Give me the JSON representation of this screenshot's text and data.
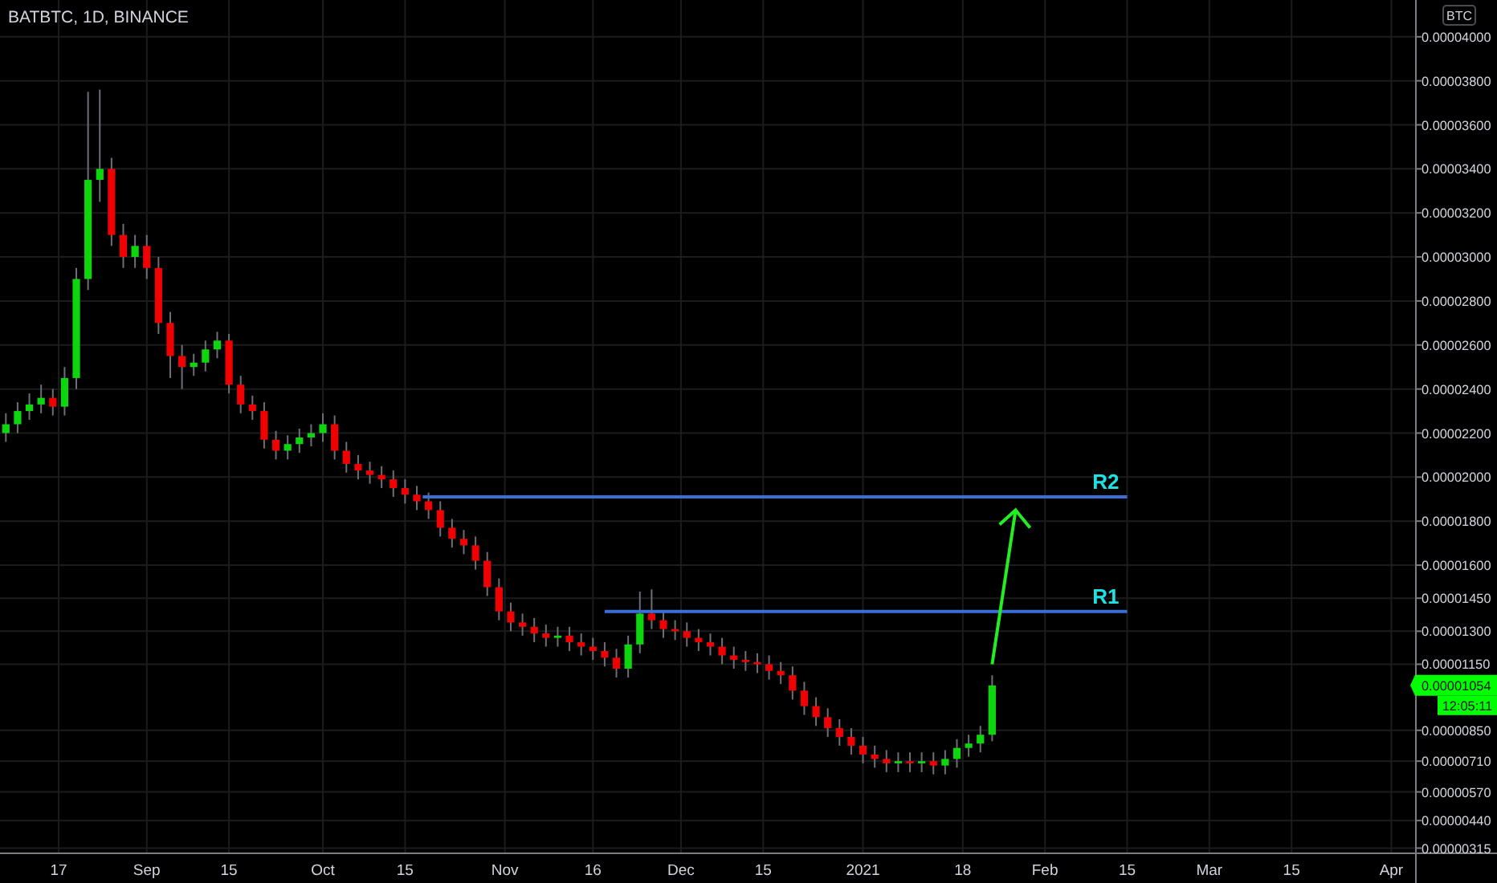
{
  "chart_title": "BATBTC, 1D, BINANCE",
  "currency_button": "BTC",
  "price_label": {
    "price": "0.00001054",
    "countdown": "12:05:11"
  },
  "chart_data": {
    "type": "candlestick",
    "grid": true,
    "xlim": [
      "2020-08-07",
      "2021-04-19"
    ],
    "ylim": [
      2.95e-06,
      4.167e-05
    ],
    "xticks": [
      {
        "value": "2020-08-17",
        "label": "17"
      },
      {
        "value": "2020-09-01",
        "label": "Sep"
      },
      {
        "value": "2020-09-15",
        "label": "15"
      },
      {
        "value": "2020-10-01",
        "label": "Oct"
      },
      {
        "value": "2020-10-15",
        "label": "15"
      },
      {
        "value": "2020-11-01",
        "label": "Nov"
      },
      {
        "value": "2020-11-16",
        "label": "16"
      },
      {
        "value": "2020-12-01",
        "label": "Dec"
      },
      {
        "value": "2020-12-15",
        "label": "15"
      },
      {
        "value": "2021-01-01",
        "label": "2021"
      },
      {
        "value": "2021-01-18",
        "label": "18"
      },
      {
        "value": "2021-02-01",
        "label": "Feb"
      },
      {
        "value": "2021-02-15",
        "label": "15"
      },
      {
        "value": "2021-03-01",
        "label": "Mar"
      },
      {
        "value": "2021-03-15",
        "label": "15"
      },
      {
        "value": "2021-04-01",
        "label": "Apr"
      }
    ],
    "yticks": [
      {
        "value": 4e-05,
        "label": "0.00004000"
      },
      {
        "value": 3.8e-05,
        "label": "0.00003800"
      },
      {
        "value": 3.6e-05,
        "label": "0.00003600"
      },
      {
        "value": 3.4e-05,
        "label": "0.00003400"
      },
      {
        "value": 3.2e-05,
        "label": "0.00003200"
      },
      {
        "value": 3e-05,
        "label": "0.00003000"
      },
      {
        "value": 2.8e-05,
        "label": "0.00002800"
      },
      {
        "value": 2.6e-05,
        "label": "0.00002600"
      },
      {
        "value": 2.4e-05,
        "label": "0.00002400"
      },
      {
        "value": 2.2e-05,
        "label": "0.00002200"
      },
      {
        "value": 2e-05,
        "label": "0.00002000"
      },
      {
        "value": 1.8e-05,
        "label": "0.00001800"
      },
      {
        "value": 1.6e-05,
        "label": "0.00001600"
      },
      {
        "value": 1.45e-05,
        "label": "0.00001450"
      },
      {
        "value": 1.3e-05,
        "label": "0.00001300"
      },
      {
        "value": 1.15e-05,
        "label": "0.00001150"
      },
      {
        "value": 8.5e-06,
        "label": "0.00000850"
      },
      {
        "value": 7.1e-06,
        "label": "0.00000710"
      },
      {
        "value": 5.7e-06,
        "label": "0.00000570"
      },
      {
        "value": 4.4e-06,
        "label": "0.00000440"
      },
      {
        "value": 3.15e-06,
        "label": "0.00000315"
      }
    ],
    "x": [
      "2020-08-08",
      "2020-08-10",
      "2020-08-12",
      "2020-08-14",
      "2020-08-16",
      "2020-08-18",
      "2020-08-20",
      "2020-08-22",
      "2020-08-24",
      "2020-08-26",
      "2020-08-28",
      "2020-08-30",
      "2020-09-01",
      "2020-09-03",
      "2020-09-05",
      "2020-09-07",
      "2020-09-09",
      "2020-09-11",
      "2020-09-13",
      "2020-09-15",
      "2020-09-17",
      "2020-09-19",
      "2020-09-21",
      "2020-09-23",
      "2020-09-25",
      "2020-09-27",
      "2020-09-29",
      "2020-10-01",
      "2020-10-03",
      "2020-10-05",
      "2020-10-07",
      "2020-10-09",
      "2020-10-11",
      "2020-10-13",
      "2020-10-15",
      "2020-10-17",
      "2020-10-19",
      "2020-10-21",
      "2020-10-23",
      "2020-10-25",
      "2020-10-27",
      "2020-10-29",
      "2020-10-31",
      "2020-11-02",
      "2020-11-04",
      "2020-11-06",
      "2020-11-08",
      "2020-11-10",
      "2020-11-12",
      "2020-11-14",
      "2020-11-16",
      "2020-11-18",
      "2020-11-20",
      "2020-11-22",
      "2020-11-24",
      "2020-11-26",
      "2020-11-28",
      "2020-11-30",
      "2020-12-02",
      "2020-12-04",
      "2020-12-06",
      "2020-12-08",
      "2020-12-10",
      "2020-12-12",
      "2020-12-14",
      "2020-12-16",
      "2020-12-18",
      "2020-12-20",
      "2020-12-22",
      "2020-12-24",
      "2020-12-26",
      "2020-12-28",
      "2020-12-30",
      "2021-01-01",
      "2021-01-03",
      "2021-01-05",
      "2021-01-07",
      "2021-01-09",
      "2021-01-11",
      "2021-01-13",
      "2021-01-15",
      "2021-01-17",
      "2021-01-19",
      "2021-01-21",
      "2021-01-23"
    ],
    "ohlc": [
      [
        2.2e-05,
        2.29e-05,
        2.16e-05,
        2.24e-05
      ],
      [
        2.24e-05,
        2.34e-05,
        2.2e-05,
        2.3e-05
      ],
      [
        2.3e-05,
        2.38e-05,
        2.26e-05,
        2.33e-05
      ],
      [
        2.33e-05,
        2.42e-05,
        2.29e-05,
        2.36e-05
      ],
      [
        2.36e-05,
        2.4e-05,
        2.28e-05,
        2.32e-05
      ],
      [
        2.32e-05,
        2.5e-05,
        2.28e-05,
        2.45e-05
      ],
      [
        2.45e-05,
        2.95e-05,
        2.4e-05,
        2.9e-05
      ],
      [
        2.9e-05,
        3.75e-05,
        2.85e-05,
        3.35e-05
      ],
      [
        3.35e-05,
        3.76e-05,
        3.25e-05,
        3.4e-05
      ],
      [
        3.4e-05,
        3.45e-05,
        3.05e-05,
        3.1e-05
      ],
      [
        3.1e-05,
        3.15e-05,
        2.95e-05,
        3e-05
      ],
      [
        3e-05,
        3.1e-05,
        2.95e-05,
        3.05e-05
      ],
      [
        3.05e-05,
        3.1e-05,
        2.9e-05,
        2.95e-05
      ],
      [
        2.95e-05,
        3e-05,
        2.65e-05,
        2.7e-05
      ],
      [
        2.7e-05,
        2.75e-05,
        2.45e-05,
        2.55e-05
      ],
      [
        2.55e-05,
        2.6e-05,
        2.4e-05,
        2.5e-05
      ],
      [
        2.5e-05,
        2.56e-05,
        2.46e-05,
        2.52e-05
      ],
      [
        2.52e-05,
        2.62e-05,
        2.48e-05,
        2.58e-05
      ],
      [
        2.58e-05,
        2.66e-05,
        2.54e-05,
        2.62e-05
      ],
      [
        2.62e-05,
        2.65e-05,
        2.38e-05,
        2.42e-05
      ],
      [
        2.42e-05,
        2.46e-05,
        2.29e-05,
        2.33e-05
      ],
      [
        2.33e-05,
        2.37e-05,
        2.26e-05,
        2.3e-05
      ],
      [
        2.3e-05,
        2.34e-05,
        2.13e-05,
        2.17e-05
      ],
      [
        2.17e-05,
        2.21e-05,
        2.08e-05,
        2.12e-05
      ],
      [
        2.12e-05,
        2.19e-05,
        2.08e-05,
        2.15e-05
      ],
      [
        2.15e-05,
        2.22e-05,
        2.11e-05,
        2.18e-05
      ],
      [
        2.18e-05,
        2.24e-05,
        2.14e-05,
        2.2e-05
      ],
      [
        2.2e-05,
        2.29e-05,
        2.16e-05,
        2.24e-05
      ],
      [
        2.24e-05,
        2.28e-05,
        2.08e-05,
        2.12e-05
      ],
      [
        2.12e-05,
        2.16e-05,
        2.02e-05,
        2.06e-05
      ],
      [
        2.06e-05,
        2.1e-05,
        1.99e-05,
        2.03e-05
      ],
      [
        2.03e-05,
        2.07e-05,
        1.97e-05,
        2.01e-05
      ],
      [
        2.01e-05,
        2.05e-05,
        1.95e-05,
        1.99e-05
      ],
      [
        1.99e-05,
        2.03e-05,
        1.91e-05,
        1.95e-05
      ],
      [
        1.95e-05,
        1.99e-05,
        1.88e-05,
        1.92e-05
      ],
      [
        1.92e-05,
        1.96e-05,
        1.85e-05,
        1.89e-05
      ],
      [
        1.89e-05,
        1.93e-05,
        1.81e-05,
        1.85e-05
      ],
      [
        1.85e-05,
        1.89e-05,
        1.73e-05,
        1.77e-05
      ],
      [
        1.77e-05,
        1.81e-05,
        1.68e-05,
        1.72e-05
      ],
      [
        1.72e-05,
        1.76e-05,
        1.65e-05,
        1.69e-05
      ],
      [
        1.69e-05,
        1.73e-05,
        1.58e-05,
        1.62e-05
      ],
      [
        1.62e-05,
        1.66e-05,
        1.46e-05,
        1.5e-05
      ],
      [
        1.5e-05,
        1.54e-05,
        1.35e-05,
        1.39e-05
      ],
      [
        1.39e-05,
        1.43e-05,
        1.3e-05,
        1.34e-05
      ],
      [
        1.34e-05,
        1.38e-05,
        1.28e-05,
        1.32e-05
      ],
      [
        1.32e-05,
        1.36e-05,
        1.25e-05,
        1.29e-05
      ],
      [
        1.29e-05,
        1.33e-05,
        1.23e-05,
        1.27e-05
      ],
      [
        1.27e-05,
        1.32e-05,
        1.23e-05,
        1.28e-05
      ],
      [
        1.28e-05,
        1.32e-05,
        1.21e-05,
        1.25e-05
      ],
      [
        1.25e-05,
        1.29e-05,
        1.19e-05,
        1.23e-05
      ],
      [
        1.23e-05,
        1.27e-05,
        1.17e-05,
        1.21e-05
      ],
      [
        1.21e-05,
        1.25e-05,
        1.14e-05,
        1.18e-05
      ],
      [
        1.18e-05,
        1.22e-05,
        1.09e-05,
        1.13e-05
      ],
      [
        1.13e-05,
        1.28e-05,
        1.09e-05,
        1.24e-05
      ],
      [
        1.24e-05,
        1.48e-05,
        1.2e-05,
        1.38e-05
      ],
      [
        1.38e-05,
        1.49e-05,
        1.31e-05,
        1.35e-05
      ],
      [
        1.35e-05,
        1.39e-05,
        1.27e-05,
        1.31e-05
      ],
      [
        1.31e-05,
        1.35e-05,
        1.26e-05,
        1.3e-05
      ],
      [
        1.3e-05,
        1.34e-05,
        1.23e-05,
        1.27e-05
      ],
      [
        1.27e-05,
        1.31e-05,
        1.21e-05,
        1.25e-05
      ],
      [
        1.25e-05,
        1.29e-05,
        1.19e-05,
        1.23e-05
      ],
      [
        1.23e-05,
        1.27e-05,
        1.15e-05,
        1.19e-05
      ],
      [
        1.19e-05,
        1.23e-05,
        1.13e-05,
        1.17e-05
      ],
      [
        1.17e-05,
        1.21e-05,
        1.12e-05,
        1.16e-05
      ],
      [
        1.16e-05,
        1.2e-05,
        1.11e-05,
        1.15e-05
      ],
      [
        1.15e-05,
        1.19e-05,
        1.08e-05,
        1.12e-05
      ],
      [
        1.12e-05,
        1.16e-05,
        1.06e-05,
        1.1e-05
      ],
      [
        1.1e-05,
        1.14e-05,
        9.9e-06,
        1.03e-05
      ],
      [
        1.03e-05,
        1.07e-05,
        9.2e-06,
        9.6e-06
      ],
      [
        9.6e-06,
        1e-05,
        8.7e-06,
        9.1e-06
      ],
      [
        9.1e-06,
        9.5e-06,
        8.2e-06,
        8.6e-06
      ],
      [
        8.6e-06,
        9e-06,
        7.8e-06,
        8.2e-06
      ],
      [
        8.2e-06,
        8.6e-06,
        7.4e-06,
        7.8e-06
      ],
      [
        7.8e-06,
        8.2e-06,
        7e-06,
        7.4e-06
      ],
      [
        7.4e-06,
        7.8e-06,
        6.8e-06,
        7.2e-06
      ],
      [
        7.2e-06,
        7.6e-06,
        6.6e-06,
        7e-06
      ],
      [
        7e-06,
        7.5e-06,
        6.6e-06,
        7.1e-06
      ],
      [
        7.1e-06,
        7.5e-06,
        6.6e-06,
        7e-06
      ],
      [
        7e-06,
        7.5e-06,
        6.6e-06,
        7.1e-06
      ],
      [
        7.1e-06,
        7.5e-06,
        6.5e-06,
        6.9e-06
      ],
      [
        6.9e-06,
        7.6e-06,
        6.5e-06,
        7.2e-06
      ],
      [
        7.2e-06,
        8.1e-06,
        6.8e-06,
        7.7e-06
      ],
      [
        7.7e-06,
        8.3e-06,
        7.3e-06,
        7.9e-06
      ],
      [
        7.9e-06,
        8.7e-06,
        7.5e-06,
        8.3e-06
      ],
      [
        8.3e-06,
        1.1e-05,
        8e-06,
        1.054e-05
      ]
    ]
  },
  "drawings": [
    {
      "kind": "level",
      "label": "R2"
    },
    {
      "kind": "level",
      "label": "R1"
    },
    {
      "kind": "arrow"
    }
  ]
}
